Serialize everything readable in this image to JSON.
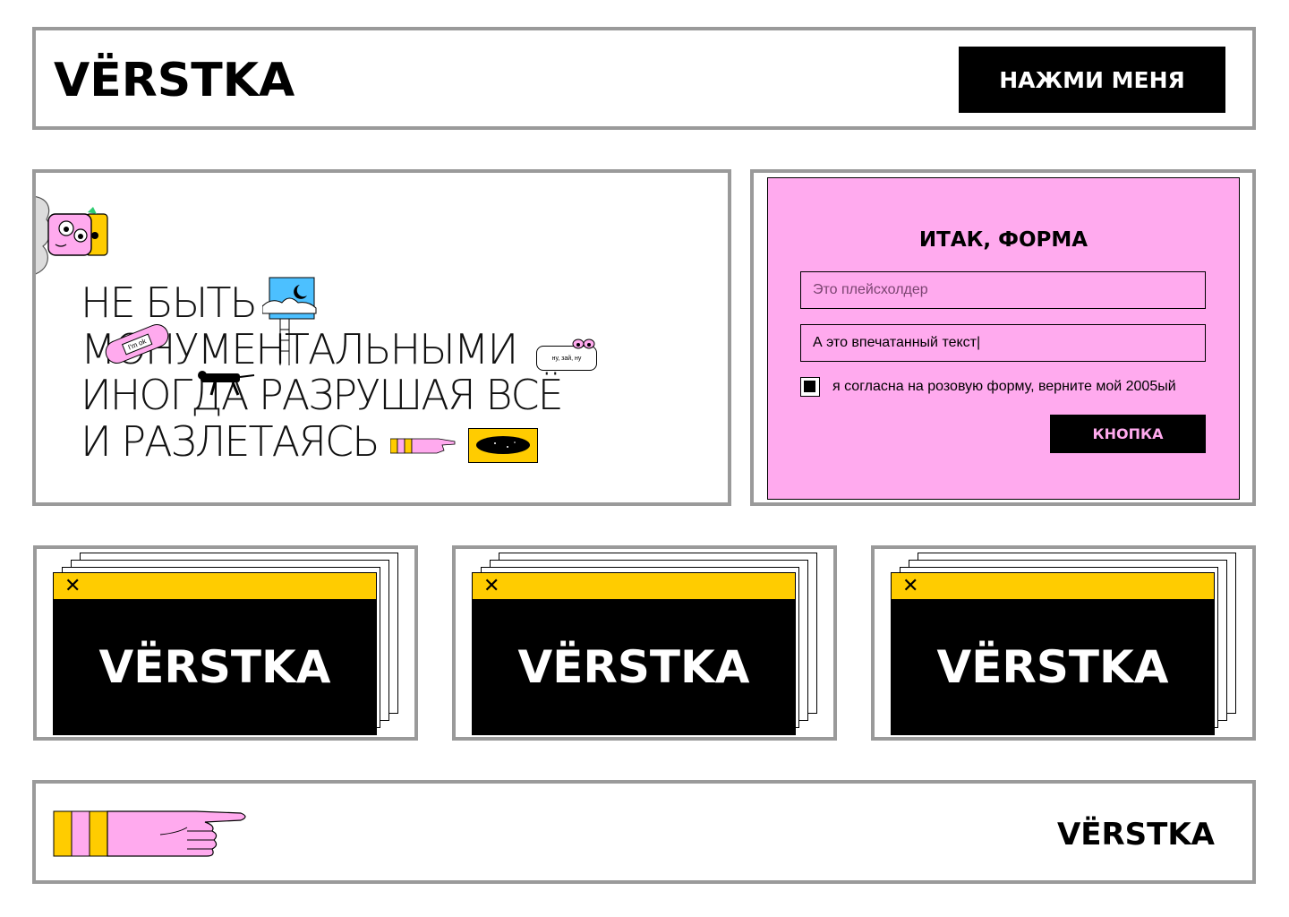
{
  "header": {
    "logo": "VЁRSTKA",
    "button_label": "НАЖМИ МЕНЯ"
  },
  "hero": {
    "lines": [
      "НЕ БЫТЬ",
      "МОНУМЕНТАЛЬНЫМИ",
      "ИНОГДА РАЗРУШАЯ ВСЁ",
      "И РАЗЛЕТАЯСЬ"
    ],
    "sticker_bandage": "I'm ok",
    "sticker_bubble": "ну, зай, ну"
  },
  "form": {
    "title": "ИТАК, ФОРМА",
    "placeholder": "Это плейсхолдер",
    "typed_value": "А это впечатанный текст|",
    "checkbox_label": "я согласна на розовую форму, верните мой 2005ый",
    "checkbox_checked": true,
    "button_label": "КНОПКА"
  },
  "cards": [
    {
      "logo": "VЁRSTKA",
      "close": "✕"
    },
    {
      "logo": "VЁRSTKA",
      "close": "✕"
    },
    {
      "logo": "VЁRSTKA",
      "close": "✕"
    }
  ],
  "footer": {
    "logo": "VЁRSTKA"
  },
  "colors": {
    "pink": "#ffaaee",
    "yellow": "#ffcc00",
    "sky": "#4cc0ff",
    "frame": "#9a9a9a"
  }
}
